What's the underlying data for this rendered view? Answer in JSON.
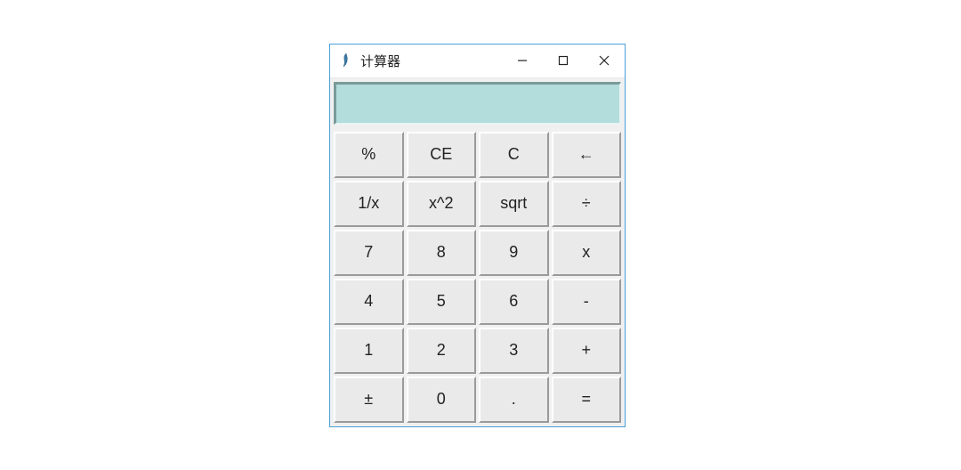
{
  "window": {
    "title": "计算器"
  },
  "display": {
    "value": ""
  },
  "buttons": {
    "r0c0": "%",
    "r0c1": "CE",
    "r0c2": "C",
    "r0c3": "←",
    "r1c0": "1/x",
    "r1c1": "x^2",
    "r1c2": "sqrt",
    "r1c3": "÷",
    "r2c0": "7",
    "r2c1": "8",
    "r2c2": "9",
    "r2c3": "x",
    "r3c0": "4",
    "r3c1": "5",
    "r3c2": "6",
    "r3c3": "-",
    "r4c0": "1",
    "r4c1": "2",
    "r4c2": "3",
    "r4c3": "+",
    "r5c0": "±",
    "r5c1": "0",
    "r5c2": ".",
    "r5c3": "="
  }
}
